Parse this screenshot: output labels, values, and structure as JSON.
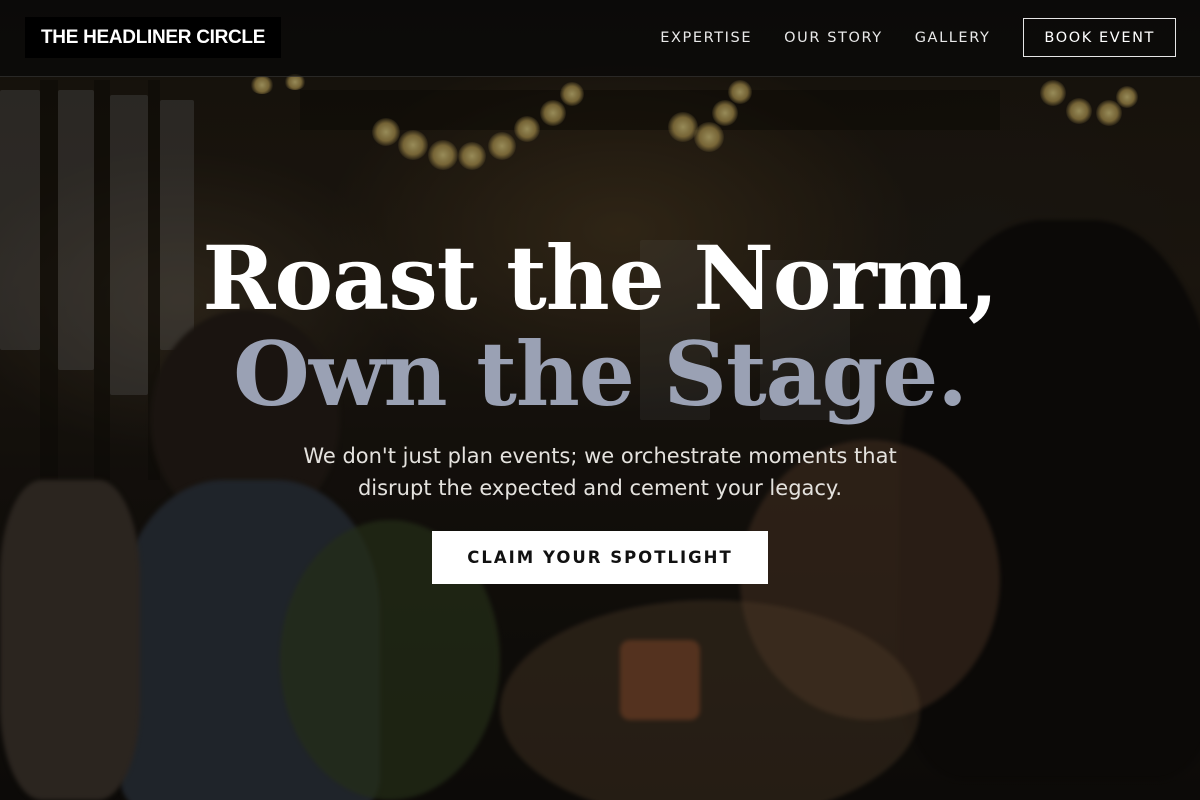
{
  "brand": {
    "name": "THE HEADLINER CIRCLE"
  },
  "nav": {
    "items": [
      {
        "label": "EXPERTISE"
      },
      {
        "label": "OUR STORY"
      },
      {
        "label": "GALLERY"
      }
    ],
    "cta_label": "BOOK EVENT"
  },
  "hero": {
    "headline_line1": "Roast the Norm,",
    "headline_line2": "Own the Stage.",
    "subtitle_line1": "We don't just plan events; we orchestrate moments that",
    "subtitle_line2": "disrupt the expected and cement your legacy.",
    "cta_label": "CLAIM YOUR SPOTLIGHT"
  },
  "colors": {
    "header_bg": "#080808",
    "accent_muted": "#9aa1b4",
    "cta_bg": "#ffffff",
    "cta_text": "#111111"
  },
  "background_image": {
    "icon": "celebration-photo"
  }
}
